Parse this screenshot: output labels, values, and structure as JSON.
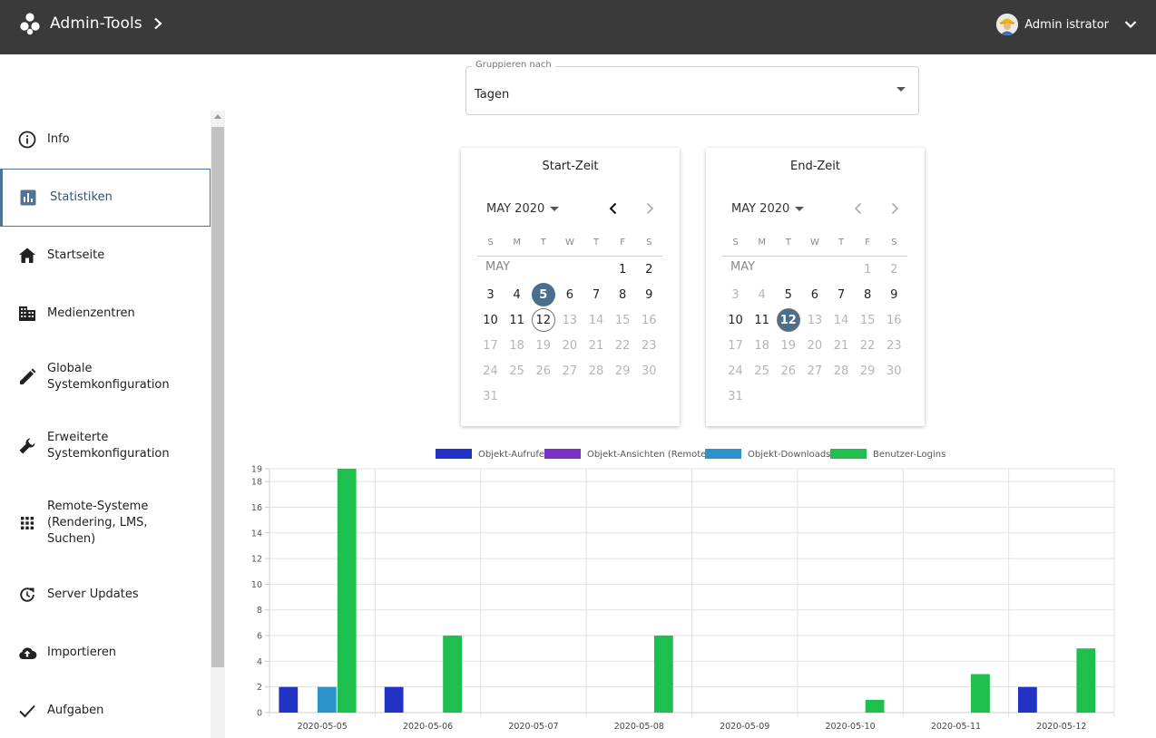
{
  "header": {
    "title": "Admin-Tools",
    "user_name": "Admin istrator"
  },
  "sidebar": {
    "items": [
      {
        "label": "Info",
        "icon": "info-icon"
      },
      {
        "label": "Statistiken",
        "icon": "bar-chart-icon",
        "active": true
      },
      {
        "label": "Startseite",
        "icon": "home-icon"
      },
      {
        "label": "Medienzentren",
        "icon": "building-icon"
      },
      {
        "label": "Globale Systemkonfiguration",
        "icon": "pencil-icon"
      },
      {
        "label": "Erweiterte Systemkonfiguration",
        "icon": "wrench-icon"
      },
      {
        "label": "Remote-Systeme (Rendering, LMS, Suchen)",
        "icon": "grid-icon"
      },
      {
        "label": "Server Updates",
        "icon": "update-icon"
      },
      {
        "label": "Importieren",
        "icon": "cloud-upload-icon"
      },
      {
        "label": "Aufgaben",
        "icon": "check-icon"
      }
    ]
  },
  "group_by": {
    "label": "Gruppieren nach",
    "value": "Tagen"
  },
  "calendars": {
    "weekdays": [
      "S",
      "M",
      "T",
      "W",
      "T",
      "F",
      "S"
    ],
    "start": {
      "title": "Start-Zeit",
      "month_label": "MAY 2020",
      "month_short": "MAY",
      "selected": 5,
      "today": 12,
      "max_enabled": 12,
      "min_enabled": 1
    },
    "end": {
      "title": "End-Zeit",
      "month_label": "MAY 2020",
      "month_short": "MAY",
      "selected": 12,
      "today": 12,
      "max_enabled": 12,
      "min_enabled": 5
    }
  },
  "colors": {
    "accent": "#4b6e8d",
    "header_bg": "#3a3a3a"
  },
  "chart_data": {
    "type": "bar",
    "categories": [
      "2020-05-05",
      "2020-05-06",
      "2020-05-07",
      "2020-05-08",
      "2020-05-09",
      "2020-05-10",
      "2020-05-11",
      "2020-05-12"
    ],
    "series": [
      {
        "name": "Objekt-Aufrufe",
        "color": "#2232c4",
        "values": [
          2,
          2,
          0,
          0,
          0,
          0,
          0,
          2
        ]
      },
      {
        "name": "Objekt-Ansichten (Remote)",
        "color": "#7b2fc4",
        "values": [
          0,
          0,
          0,
          0,
          0,
          0,
          0,
          0
        ]
      },
      {
        "name": "Objekt-Downloads",
        "color": "#2b93c9",
        "values": [
          2,
          0,
          0,
          0,
          0,
          0,
          0,
          0
        ]
      },
      {
        "name": "Benutzer-Logins",
        "color": "#1ebf4c",
        "values": [
          19,
          6,
          0,
          6,
          0,
          1,
          3,
          5
        ]
      }
    ],
    "yticks": [
      0,
      2,
      4,
      6,
      8,
      10,
      12,
      14,
      16,
      18,
      19
    ],
    "ylim": [
      0,
      19
    ],
    "legend": "top",
    "grid": true
  }
}
